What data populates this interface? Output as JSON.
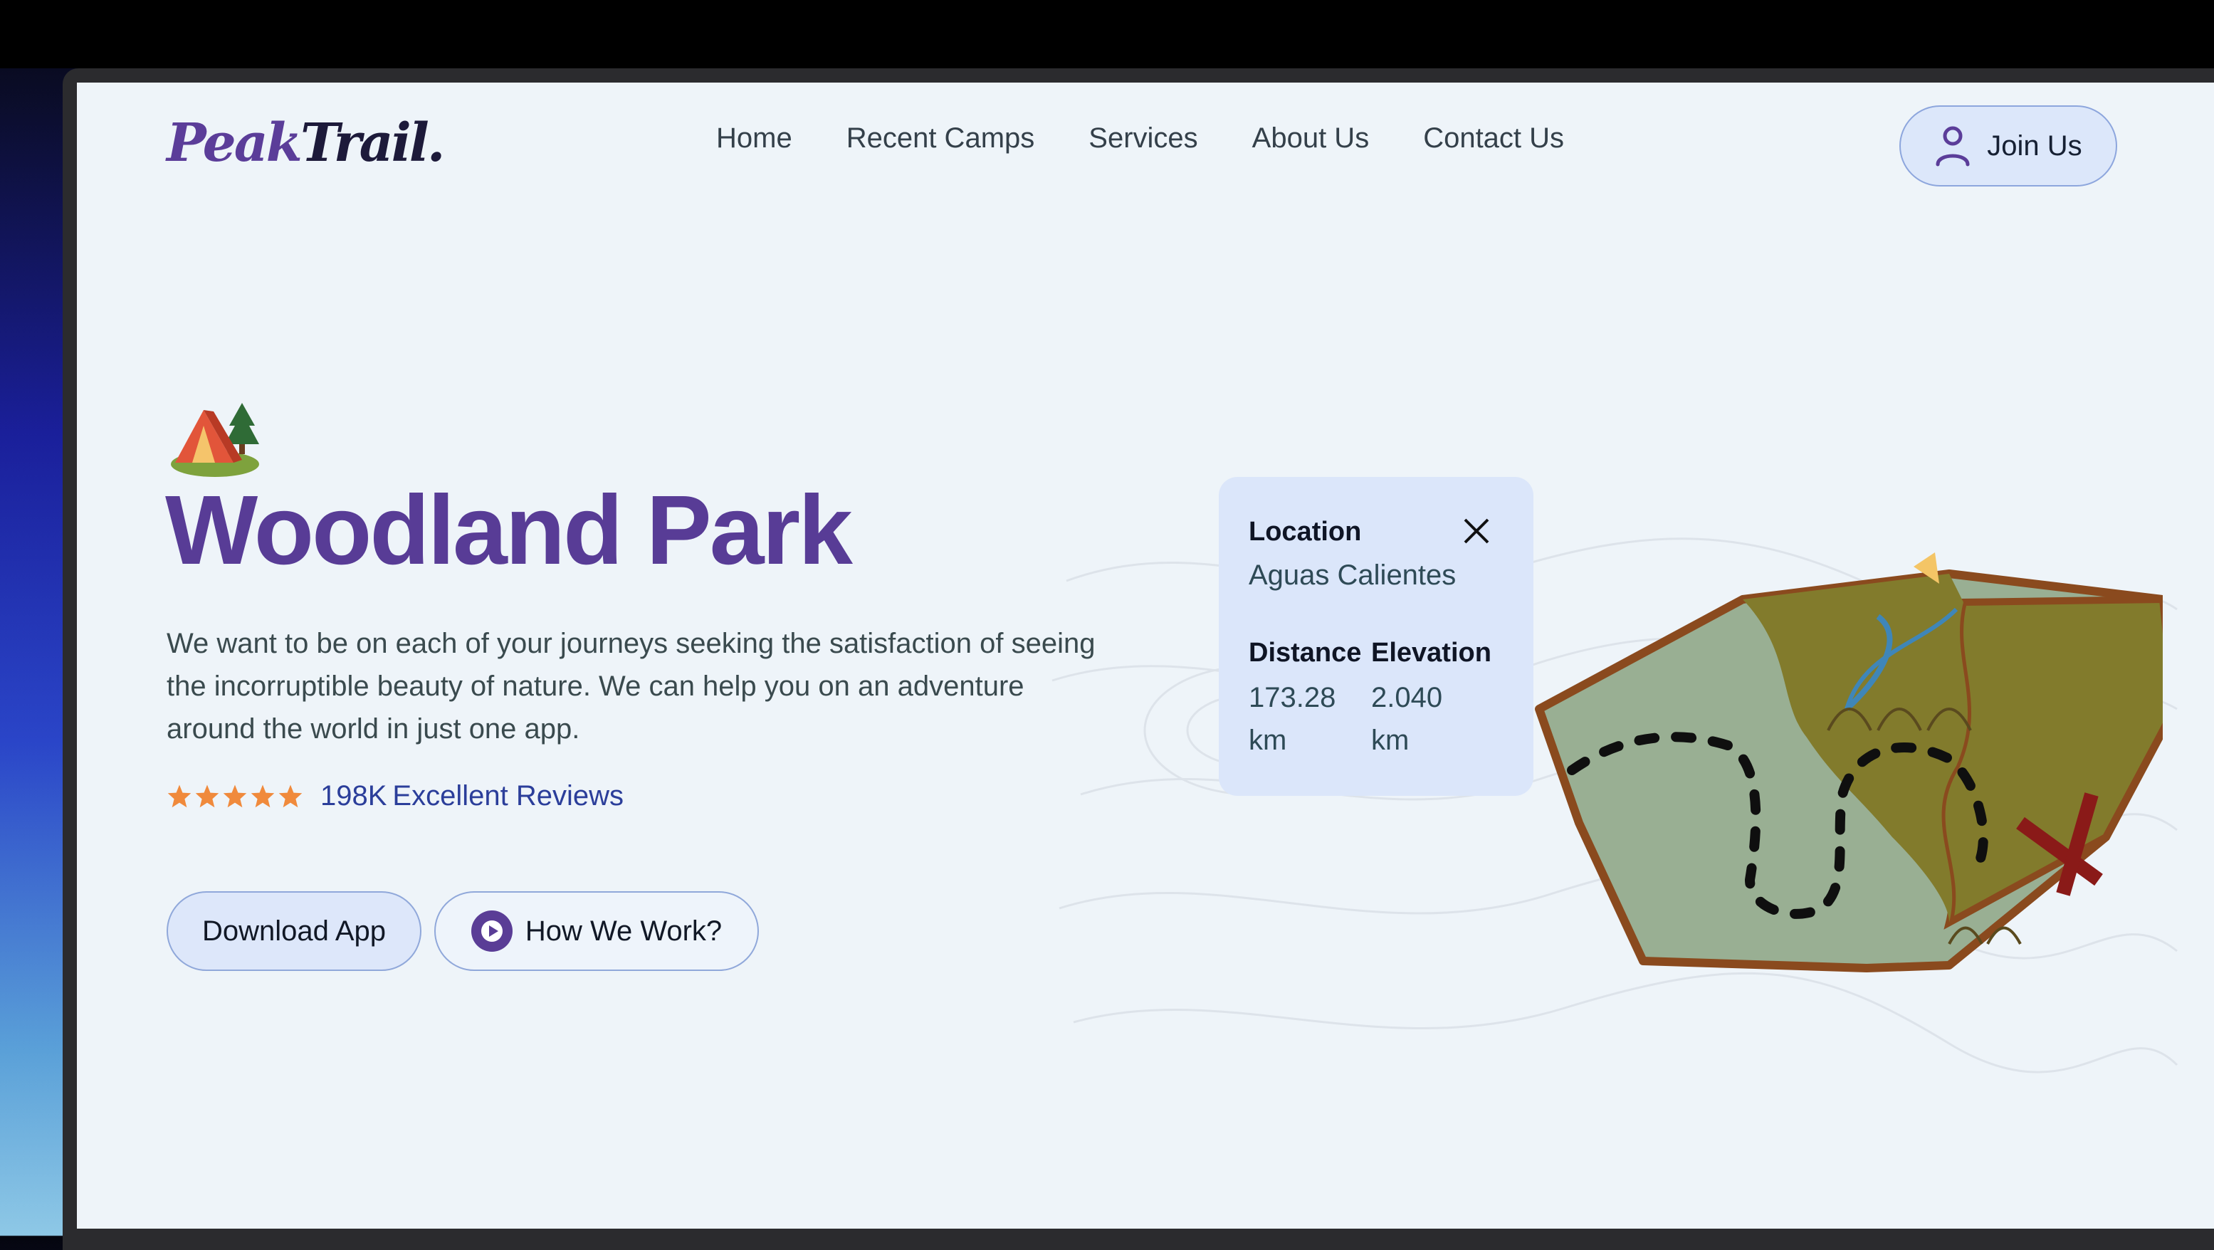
{
  "brand": {
    "logo_part1": "Peak",
    "logo_part2": "Trail."
  },
  "nav": {
    "items": [
      "Home",
      "Recent Camps",
      "Services",
      "About Us",
      "Contact Us"
    ]
  },
  "join": {
    "label": "Join Us"
  },
  "hero": {
    "title": "Woodland Park",
    "description": "We want to be on each of your journeys seeking the satisfaction of seeing the incorruptible beauty of nature. We can help you on an adventure around the world in just one app.",
    "rating_stars": 5,
    "reviews_count": "198K",
    "reviews_label": "Excellent Reviews",
    "download_label": "Download App",
    "how_label": "How We Work?"
  },
  "location_card": {
    "location_label": "Location",
    "location_value": "Aguas Calientes",
    "distance_label": "Distance",
    "distance_value_1": "173.28",
    "distance_value_2": "km",
    "elevation_label": "Elevation",
    "elevation_value_1": "2.040",
    "elevation_value_2": "km"
  },
  "colors": {
    "brand_purple": "#583c96",
    "page_bg": "#eef4f9",
    "accent_blue": "#2b3e9a",
    "star": "#f08a3c"
  }
}
